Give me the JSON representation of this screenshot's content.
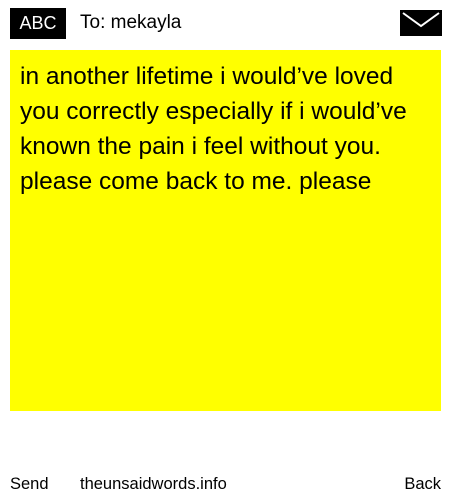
{
  "header": {
    "badge_label": "ABC",
    "recipient": "To: mekayla",
    "mail_icon": "envelope-icon"
  },
  "message": {
    "text": "in another lifetime i would’ve loved you correctly especially if i would’ve known the pain i feel without you. please come back to me. please",
    "background_color": "#ffff00"
  },
  "footer": {
    "send_label": "Send",
    "site_label": "theunsaidwords.info",
    "back_label": "Back"
  }
}
